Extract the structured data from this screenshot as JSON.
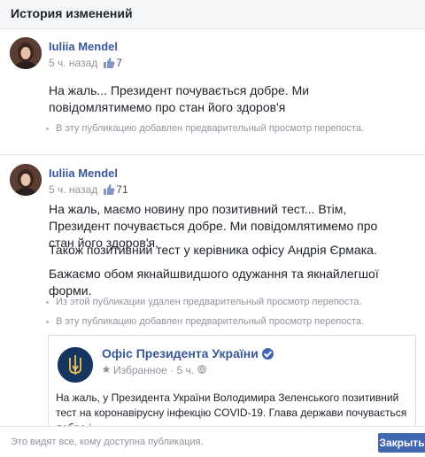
{
  "dialog": {
    "title": "История изменений",
    "footer_note": "Это видят все, кому доступна публикация.",
    "close_label": "Закрыть"
  },
  "posts": [
    {
      "author": "Iuliia Mendel",
      "time": "5 ч. назад",
      "likes": "7",
      "paragraphs": [
        "На жаль... Президент почувається добре. Ми повідомлятимемо про стан його здоров'я"
      ],
      "notes": [
        "В эту публикацию добавлен предварительный просмотр перепоста."
      ]
    },
    {
      "author": "Iuliia Mendel",
      "time": "5 ч. назад",
      "likes": "71",
      "paragraphs": [
        "На жаль, маємо новину про позитивний тест... Втім, Президент почувається добре. Ми повідомлятимемо про стан його здоров'я.",
        "Також позитивний тест у керівника офісу Андрія Єрмака.",
        "Бажаємо обом якнайшвидшого одужання та якнайлегшої форми."
      ],
      "notes": [
        "Из этой публикации удален предварительный просмотр перепоста.",
        "В эту публикацию добавлен предварительный просмотр перепоста."
      ],
      "shared": {
        "name": "Офіс Президента України",
        "meta_label": "Избранное",
        "time": "5 ч.",
        "text": "На жаль, у Президента України Володимира Зеленського позитивний тест на коронавірусну інфекцію COVID-19. Глава держави почувається добре і"
      }
    }
  ],
  "icons": {
    "like": "thumbs-up-icon",
    "verified": "verified-badge-icon",
    "favorite": "star-icon"
  },
  "colors": {
    "link": "#385898",
    "button": "#4267b2",
    "muted": "#90949c"
  }
}
